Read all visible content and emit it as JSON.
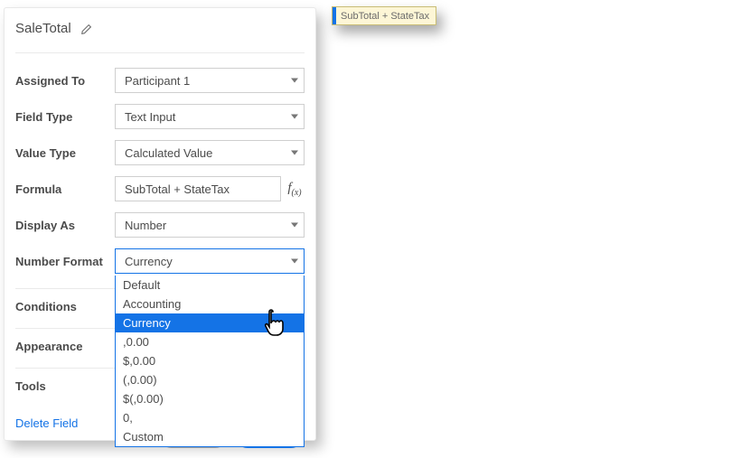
{
  "field_name": "SaleTotal",
  "rows": {
    "assigned_to": {
      "label": "Assigned To",
      "value": "Participant 1"
    },
    "field_type": {
      "label": "Field Type",
      "value": "Text Input"
    },
    "value_type": {
      "label": "Value Type",
      "value": "Calculated Value"
    },
    "formula": {
      "label": "Formula",
      "value": "SubTotal + StateTax"
    },
    "display_as": {
      "label": "Display As",
      "value": "Number"
    },
    "number_format": {
      "label": "Number Format",
      "value": "Currency"
    }
  },
  "number_format_options": [
    "Default",
    "Accounting",
    "Currency",
    ",0.00",
    "$,0.00",
    "(,0.00)",
    "$(,0.00)",
    "0,",
    "Custom"
  ],
  "number_format_selected_index": 2,
  "sections": {
    "conditions": "Conditions",
    "appearance": "Appearance",
    "tools": "Tools"
  },
  "delete_label": "Delete Field",
  "preview_text": "SubTotal + StateTax"
}
